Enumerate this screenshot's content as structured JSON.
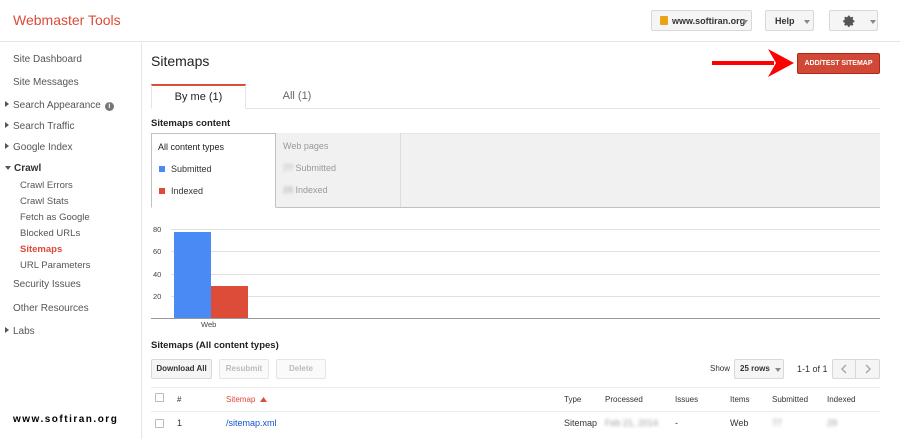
{
  "app": {
    "title": "Webmaster Tools"
  },
  "header": {
    "site_selector": "www.softiran.org",
    "help_label": "Help",
    "settings_icon": "gear-icon"
  },
  "sidebar": {
    "items": [
      {
        "label": "Site Dashboard"
      },
      {
        "label": "Site Messages"
      },
      {
        "label": "Search Appearance"
      },
      {
        "label": "Search Traffic"
      },
      {
        "label": "Google Index"
      },
      {
        "label": "Crawl"
      },
      {
        "label": "Security Issues"
      },
      {
        "label": "Other Resources"
      },
      {
        "label": "Labs"
      }
    ],
    "crawl_children": [
      {
        "label": "Crawl Errors"
      },
      {
        "label": "Crawl Stats"
      },
      {
        "label": "Fetch as Google"
      },
      {
        "label": "Blocked URLs"
      },
      {
        "label": "Sitemaps"
      },
      {
        "label": "URL Parameters"
      }
    ],
    "info_glyph": "i"
  },
  "watermark": "www.softiran.org",
  "main": {
    "title": "Sitemaps",
    "add_button": "ADD/TEST SITEMAP",
    "tabs": [
      {
        "label": "By me (1)"
      },
      {
        "label": "All (1)"
      }
    ],
    "content_title": "Sitemaps content",
    "content_types": {
      "header": "All content types",
      "submitted": "Submitted",
      "indexed": "Indexed"
    },
    "web_pages": {
      "header": "Web pages",
      "submitted_value": "77",
      "submitted_label": "Submitted",
      "indexed_value": "29",
      "indexed_label": "Indexed"
    },
    "table_title": "Sitemaps (All content types)",
    "actions": {
      "download_all": "Download All",
      "resubmit": "Resubmit",
      "delete": "Delete"
    },
    "pagination": {
      "show_label": "Show",
      "rows_select": "25 rows",
      "range": "1-1 of 1"
    },
    "table": {
      "headers": {
        "num": "#",
        "sitemap": "Sitemap",
        "type": "Type",
        "processed": "Processed",
        "issues": "Issues",
        "items": "Items",
        "submitted": "Submitted",
        "indexed": "Indexed"
      },
      "rows": [
        {
          "num": "1",
          "sitemap": "/sitemap.xml",
          "type": "Sitemap",
          "processed": "Feb 21, 2014",
          "issues": "-",
          "items": "Web",
          "submitted": "77",
          "indexed": "29"
        }
      ]
    }
  },
  "colors": {
    "brand_red": "#dd4b39",
    "submitted_blue": "#4a8af4",
    "indexed_red": "#dd4b39"
  },
  "chart_data": {
    "type": "bar",
    "categories": [
      "Web"
    ],
    "series": [
      {
        "name": "Submitted",
        "values": [
          77
        ]
      },
      {
        "name": "Indexed",
        "values": [
          29
        ]
      }
    ],
    "ylim": [
      0,
      90
    ],
    "yticks": [
      20,
      40,
      60,
      80
    ],
    "grid": true
  }
}
